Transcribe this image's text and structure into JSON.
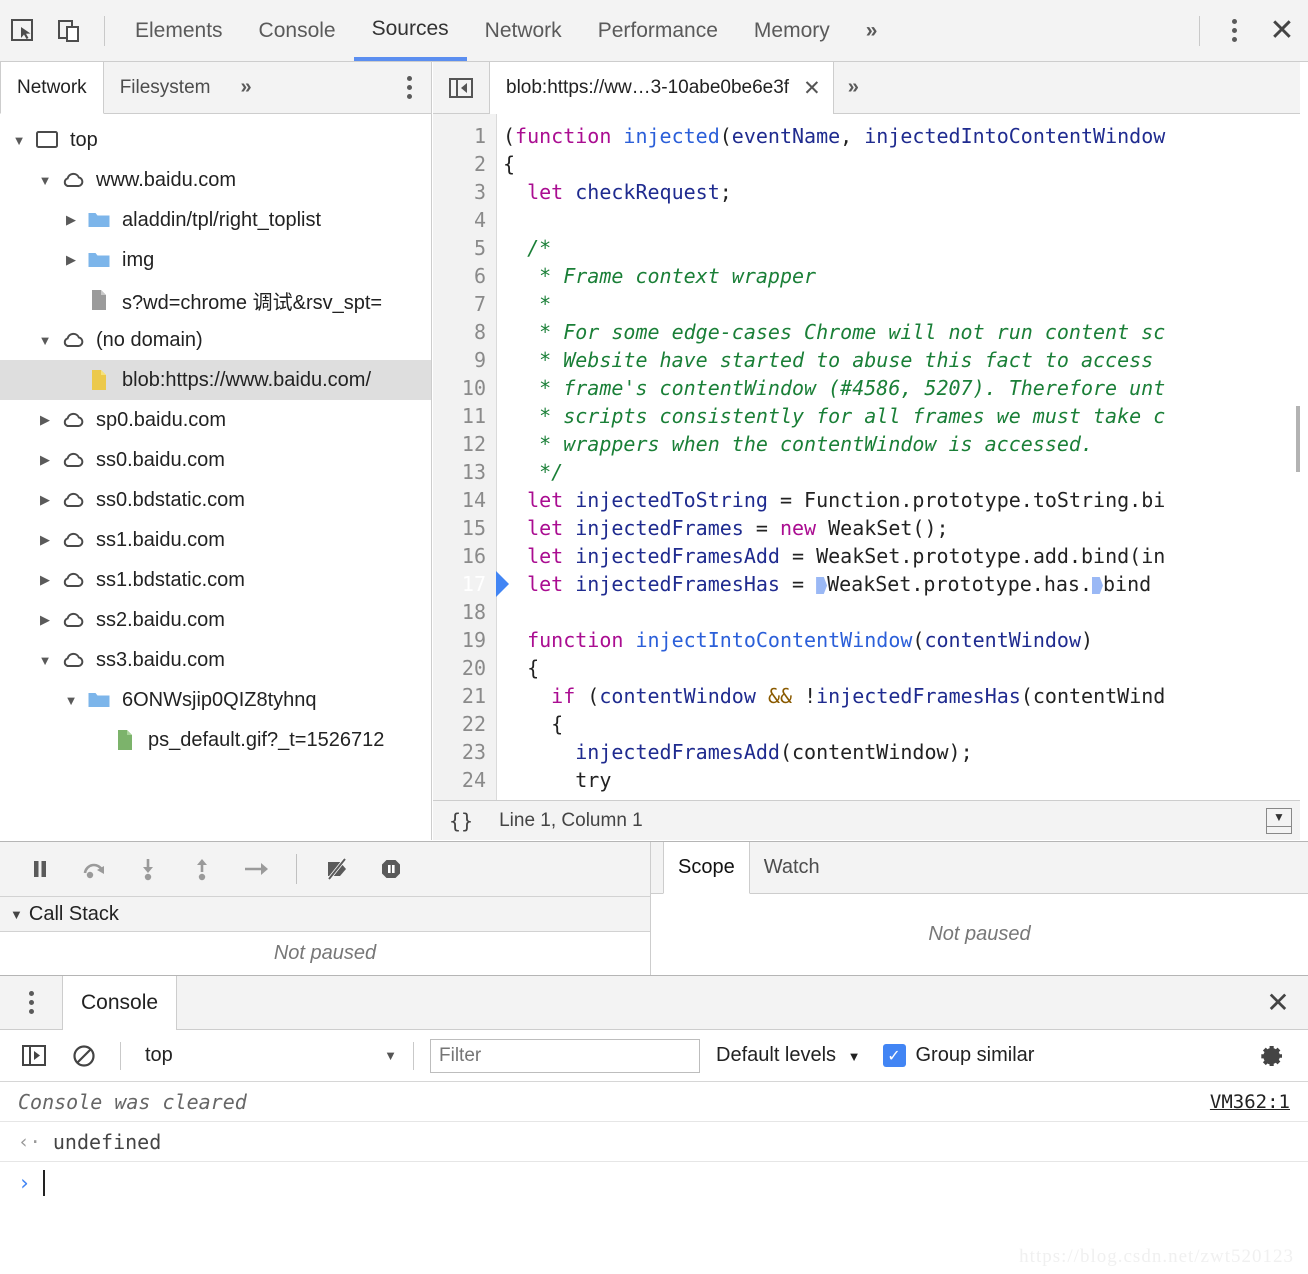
{
  "toolbar": {
    "inspect_icon": "cursor-select-icon",
    "device_icon": "device-toggle-icon",
    "tabs": [
      {
        "label": "Elements",
        "active": false
      },
      {
        "label": "Console",
        "active": false
      },
      {
        "label": "Sources",
        "active": true
      },
      {
        "label": "Network",
        "active": false
      },
      {
        "label": "Performance",
        "active": false
      },
      {
        "label": "Memory",
        "active": false
      }
    ],
    "more_label": "»",
    "kebab_icon": "more-options-icon",
    "close_icon": "close-icon",
    "close_label": "✕"
  },
  "navigator": {
    "tabs": [
      {
        "label": "Network",
        "active": true
      },
      {
        "label": "Filesystem",
        "active": false
      }
    ],
    "more_label": "»",
    "tree": [
      {
        "label": "top",
        "icon": "frame-icon",
        "indent": 0,
        "twisty": "open",
        "selected": false
      },
      {
        "label": "www.baidu.com",
        "icon": "cloud-icon",
        "indent": 1,
        "twisty": "open",
        "selected": false
      },
      {
        "label": "aladdin/tpl/right_toplist",
        "icon": "folder-blue-icon",
        "indent": 2,
        "twisty": "closed",
        "selected": false
      },
      {
        "label": "img",
        "icon": "folder-blue-icon",
        "indent": 2,
        "twisty": "closed",
        "selected": false
      },
      {
        "label": "s?wd=chrome 调试&rsv_spt=",
        "icon": "file-gray-icon",
        "indent": 2,
        "twisty": "none",
        "selected": false
      },
      {
        "label": "(no domain)",
        "icon": "cloud-icon",
        "indent": 1,
        "twisty": "open",
        "selected": false
      },
      {
        "label": "blob:https://www.baidu.com/",
        "icon": "file-yellow-icon",
        "indent": 2,
        "twisty": "none",
        "selected": true
      },
      {
        "label": "sp0.baidu.com",
        "icon": "cloud-icon",
        "indent": 1,
        "twisty": "closed",
        "selected": false
      },
      {
        "label": "ss0.baidu.com",
        "icon": "cloud-icon",
        "indent": 1,
        "twisty": "closed",
        "selected": false
      },
      {
        "label": "ss0.bdstatic.com",
        "icon": "cloud-icon",
        "indent": 1,
        "twisty": "closed",
        "selected": false
      },
      {
        "label": "ss1.baidu.com",
        "icon": "cloud-icon",
        "indent": 1,
        "twisty": "closed",
        "selected": false
      },
      {
        "label": "ss1.bdstatic.com",
        "icon": "cloud-icon",
        "indent": 1,
        "twisty": "closed",
        "selected": false
      },
      {
        "label": "ss2.baidu.com",
        "icon": "cloud-icon",
        "indent": 1,
        "twisty": "closed",
        "selected": false
      },
      {
        "label": "ss3.baidu.com",
        "icon": "cloud-icon",
        "indent": 1,
        "twisty": "open",
        "selected": false
      },
      {
        "label": "6ONWsjip0QIZ8tyhnq",
        "icon": "folder-blue-icon",
        "indent": 2,
        "twisty": "open",
        "selected": false
      },
      {
        "label": "ps_default.gif?_t=1526712",
        "icon": "file-green-icon",
        "indent": 3,
        "twisty": "none",
        "selected": false
      }
    ]
  },
  "editor": {
    "back_icon": "navigator-toggle-icon",
    "tab_title": "blob:https://ww…3-10abe0be6e3f",
    "tab_close": "✕",
    "more_label": "»",
    "current_line": 17,
    "status": {
      "format_icon": "pretty-print-braces",
      "format_label": "{}",
      "position": "Line 1, Column 1",
      "popout_icon": "show-drawer-icon"
    },
    "lines": [
      {
        "n": 1,
        "tokens": [
          {
            "t": "(",
            "c": "pl"
          },
          {
            "t": "function",
            "c": "kw"
          },
          {
            "t": " ",
            "c": "pl"
          },
          {
            "t": "injected",
            "c": "fn"
          },
          {
            "t": "(",
            "c": "pl"
          },
          {
            "t": "eventName",
            "c": "var"
          },
          {
            "t": ", ",
            "c": "pl"
          },
          {
            "t": "injectedIntoContentWindow",
            "c": "var"
          }
        ]
      },
      {
        "n": 2,
        "tokens": [
          {
            "t": "{",
            "c": "pl"
          }
        ]
      },
      {
        "n": 3,
        "tokens": [
          {
            "t": "  ",
            "c": "pl"
          },
          {
            "t": "let",
            "c": "kw"
          },
          {
            "t": " ",
            "c": "pl"
          },
          {
            "t": "checkRequest",
            "c": "var"
          },
          {
            "t": ";",
            "c": "pl"
          }
        ]
      },
      {
        "n": 4,
        "tokens": []
      },
      {
        "n": 5,
        "tokens": [
          {
            "t": "  /*",
            "c": "cm"
          }
        ]
      },
      {
        "n": 6,
        "tokens": [
          {
            "t": "   * Frame context wrapper",
            "c": "cm"
          }
        ]
      },
      {
        "n": 7,
        "tokens": [
          {
            "t": "   *",
            "c": "cm"
          }
        ]
      },
      {
        "n": 8,
        "tokens": [
          {
            "t": "   * For some edge-cases Chrome will not run content sc",
            "c": "cm"
          }
        ]
      },
      {
        "n": 9,
        "tokens": [
          {
            "t": "   * Website have started to abuse this fact to access ",
            "c": "cm"
          }
        ]
      },
      {
        "n": 10,
        "tokens": [
          {
            "t": "   * frame's contentWindow (#4586, 5207). Therefore unt",
            "c": "cm"
          }
        ]
      },
      {
        "n": 11,
        "tokens": [
          {
            "t": "   * scripts consistently for all frames we must take c",
            "c": "cm"
          }
        ]
      },
      {
        "n": 12,
        "tokens": [
          {
            "t": "   * wrappers when the contentWindow is accessed.",
            "c": "cm"
          }
        ]
      },
      {
        "n": 13,
        "tokens": [
          {
            "t": "   */",
            "c": "cm"
          }
        ]
      },
      {
        "n": 14,
        "tokens": [
          {
            "t": "  ",
            "c": "pl"
          },
          {
            "t": "let",
            "c": "kw"
          },
          {
            "t": " ",
            "c": "pl"
          },
          {
            "t": "injectedToString",
            "c": "var"
          },
          {
            "t": " = ",
            "c": "pl"
          },
          {
            "t": "Function.prototype.toString.bi",
            "c": "pl"
          }
        ]
      },
      {
        "n": 15,
        "tokens": [
          {
            "t": "  ",
            "c": "pl"
          },
          {
            "t": "let",
            "c": "kw"
          },
          {
            "t": " ",
            "c": "pl"
          },
          {
            "t": "injectedFrames",
            "c": "var"
          },
          {
            "t": " = ",
            "c": "pl"
          },
          {
            "t": "new",
            "c": "kw"
          },
          {
            "t": " WeakSet();",
            "c": "pl"
          }
        ]
      },
      {
        "n": 16,
        "tokens": [
          {
            "t": "  ",
            "c": "pl"
          },
          {
            "t": "let",
            "c": "kw"
          },
          {
            "t": " ",
            "c": "pl"
          },
          {
            "t": "injectedFramesAdd",
            "c": "var"
          },
          {
            "t": " = ",
            "c": "pl"
          },
          {
            "t": "WeakSet.prototype.add.bind(in",
            "c": "pl"
          }
        ]
      },
      {
        "n": 17,
        "tokens": [
          {
            "t": "  ",
            "c": "pl"
          },
          {
            "t": "let",
            "c": "kw"
          },
          {
            "t": " ",
            "c": "pl"
          },
          {
            "t": "injectedFramesHas",
            "c": "var"
          },
          {
            "t": " = ",
            "c": "pl"
          },
          {
            "t": "▶",
            "c": "bp"
          },
          {
            "t": "WeakSet.prototype.has.",
            "c": "pl"
          },
          {
            "t": "▶",
            "c": "bp"
          },
          {
            "t": "bind",
            "c": "pl"
          }
        ]
      },
      {
        "n": 18,
        "tokens": []
      },
      {
        "n": 19,
        "tokens": [
          {
            "t": "  ",
            "c": "pl"
          },
          {
            "t": "function",
            "c": "kw"
          },
          {
            "t": " ",
            "c": "pl"
          },
          {
            "t": "injectIntoContentWindow",
            "c": "fn"
          },
          {
            "t": "(",
            "c": "pl"
          },
          {
            "t": "contentWindow",
            "c": "var"
          },
          {
            "t": ")",
            "c": "pl"
          }
        ]
      },
      {
        "n": 20,
        "tokens": [
          {
            "t": "  {",
            "c": "pl"
          }
        ]
      },
      {
        "n": 21,
        "tokens": [
          {
            "t": "    ",
            "c": "pl"
          },
          {
            "t": "if",
            "c": "kw"
          },
          {
            "t": " (",
            "c": "pl"
          },
          {
            "t": "contentWindow",
            "c": "var"
          },
          {
            "t": " ",
            "c": "pl"
          },
          {
            "t": "&&",
            "c": "op"
          },
          {
            "t": " !",
            "c": "pl"
          },
          {
            "t": "injectedFramesHas",
            "c": "var"
          },
          {
            "t": "(contentWind",
            "c": "pl"
          }
        ]
      },
      {
        "n": 22,
        "tokens": [
          {
            "t": "    {",
            "c": "pl"
          }
        ]
      },
      {
        "n": 23,
        "tokens": [
          {
            "t": "      ",
            "c": "pl"
          },
          {
            "t": "injectedFramesAdd",
            "c": "var"
          },
          {
            "t": "(contentWindow);",
            "c": "pl"
          }
        ]
      },
      {
        "n": 24,
        "tokens": [
          {
            "t": "      try",
            "c": "pl"
          }
        ]
      }
    ]
  },
  "debugger": {
    "controls": [
      {
        "name": "resume-button",
        "glyph": "pause"
      },
      {
        "name": "step-over-button",
        "glyph": "step-over"
      },
      {
        "name": "step-into-button",
        "glyph": "step-into"
      },
      {
        "name": "step-out-button",
        "glyph": "step-out"
      },
      {
        "name": "step-button",
        "glyph": "step"
      },
      {
        "name": "deactivate-breakpoints-button",
        "glyph": "deactivate"
      },
      {
        "name": "pause-on-exceptions-button",
        "glyph": "pause-exceptions"
      }
    ],
    "call_stack": {
      "title": "Call Stack",
      "empty_text": "Not paused"
    },
    "scope_tabs": [
      {
        "label": "Scope",
        "active": true
      },
      {
        "label": "Watch",
        "active": false
      }
    ],
    "scope_empty_text": "Not paused"
  },
  "drawer": {
    "kebab_icon": "drawer-more-options-icon",
    "tabs": [
      {
        "label": "Console",
        "active": true
      }
    ],
    "close_label": "✕",
    "console_toolbar": {
      "sidebar_icon": "console-sidebar-icon",
      "clear_icon": "clear-console-icon",
      "context_value": "top",
      "context_caret": "▼",
      "filter_placeholder": "Filter",
      "filter_value": "",
      "levels_label": "Default levels",
      "levels_caret": "▼",
      "group_similar_label": "Group similar",
      "group_similar_checked": true,
      "group_similar_check": "✓",
      "settings_icon": "gear-icon"
    },
    "messages": [
      {
        "text": "Console was cleared",
        "source": "VM362:1",
        "style": "cleared"
      },
      {
        "arrow": "‹·",
        "text": "undefined",
        "style": "result"
      }
    ],
    "prompt_arrow": "›",
    "prompt_value": ""
  },
  "watermark": "https://blog.csdn.net/zwt520123",
  "colors": {
    "accent": "#4285f4",
    "toolbar_bg": "#f3f3f3",
    "selected_row": "#dedede",
    "comment": "#1a7f37",
    "keyword": "#aa0d91",
    "variable": "#1f2b8f",
    "function": "#2b5fd9"
  }
}
